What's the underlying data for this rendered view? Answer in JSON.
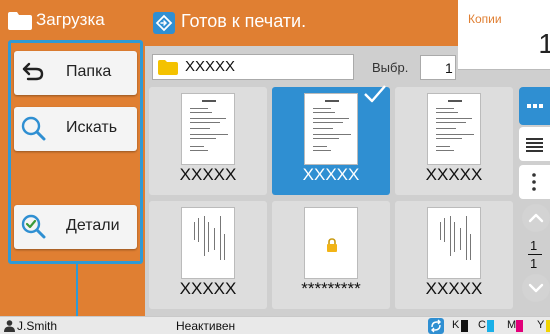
{
  "left_panel": {
    "title": "Загрузка",
    "buttons": [
      {
        "label": "Папка",
        "icon": "back-arrow-icon"
      },
      {
        "label": "Искать",
        "icon": "search-icon"
      },
      {
        "label": "Детали",
        "icon": "details-check-icon"
      }
    ]
  },
  "header": {
    "status": "Готов к печати.",
    "status_icon": "print-ready-icon",
    "copies_label": "Копии",
    "copies_value": "1"
  },
  "path_bar": {
    "folder_name": "XXXXX",
    "selected_label": "Выбр.",
    "selected_count": "1"
  },
  "thumbnails": [
    {
      "name": "XXXXX",
      "selected": false,
      "locked": false
    },
    {
      "name": "XXXXX",
      "selected": true,
      "locked": false
    },
    {
      "name": "XXXXX",
      "selected": false,
      "locked": false
    },
    {
      "name": "XXXXX",
      "selected": false,
      "locked": false
    },
    {
      "name": "*********",
      "selected": false,
      "locked": true
    },
    {
      "name": "XXXXX",
      "selected": false,
      "locked": false
    }
  ],
  "pager": {
    "current": "1",
    "total": "1"
  },
  "bottom_bar": {
    "user": "J.Smith",
    "state": "Неактивен",
    "inks": [
      {
        "label": "K",
        "color": "#111111"
      },
      {
        "label": "C",
        "color": "#1ab0e8"
      },
      {
        "label": "M",
        "color": "#e2007a"
      },
      {
        "label": "Y",
        "color": "#f2d400"
      }
    ]
  },
  "colors": {
    "accent": "#e07f32",
    "selection": "#2f8fd2",
    "callout": "#2f9ad6"
  }
}
